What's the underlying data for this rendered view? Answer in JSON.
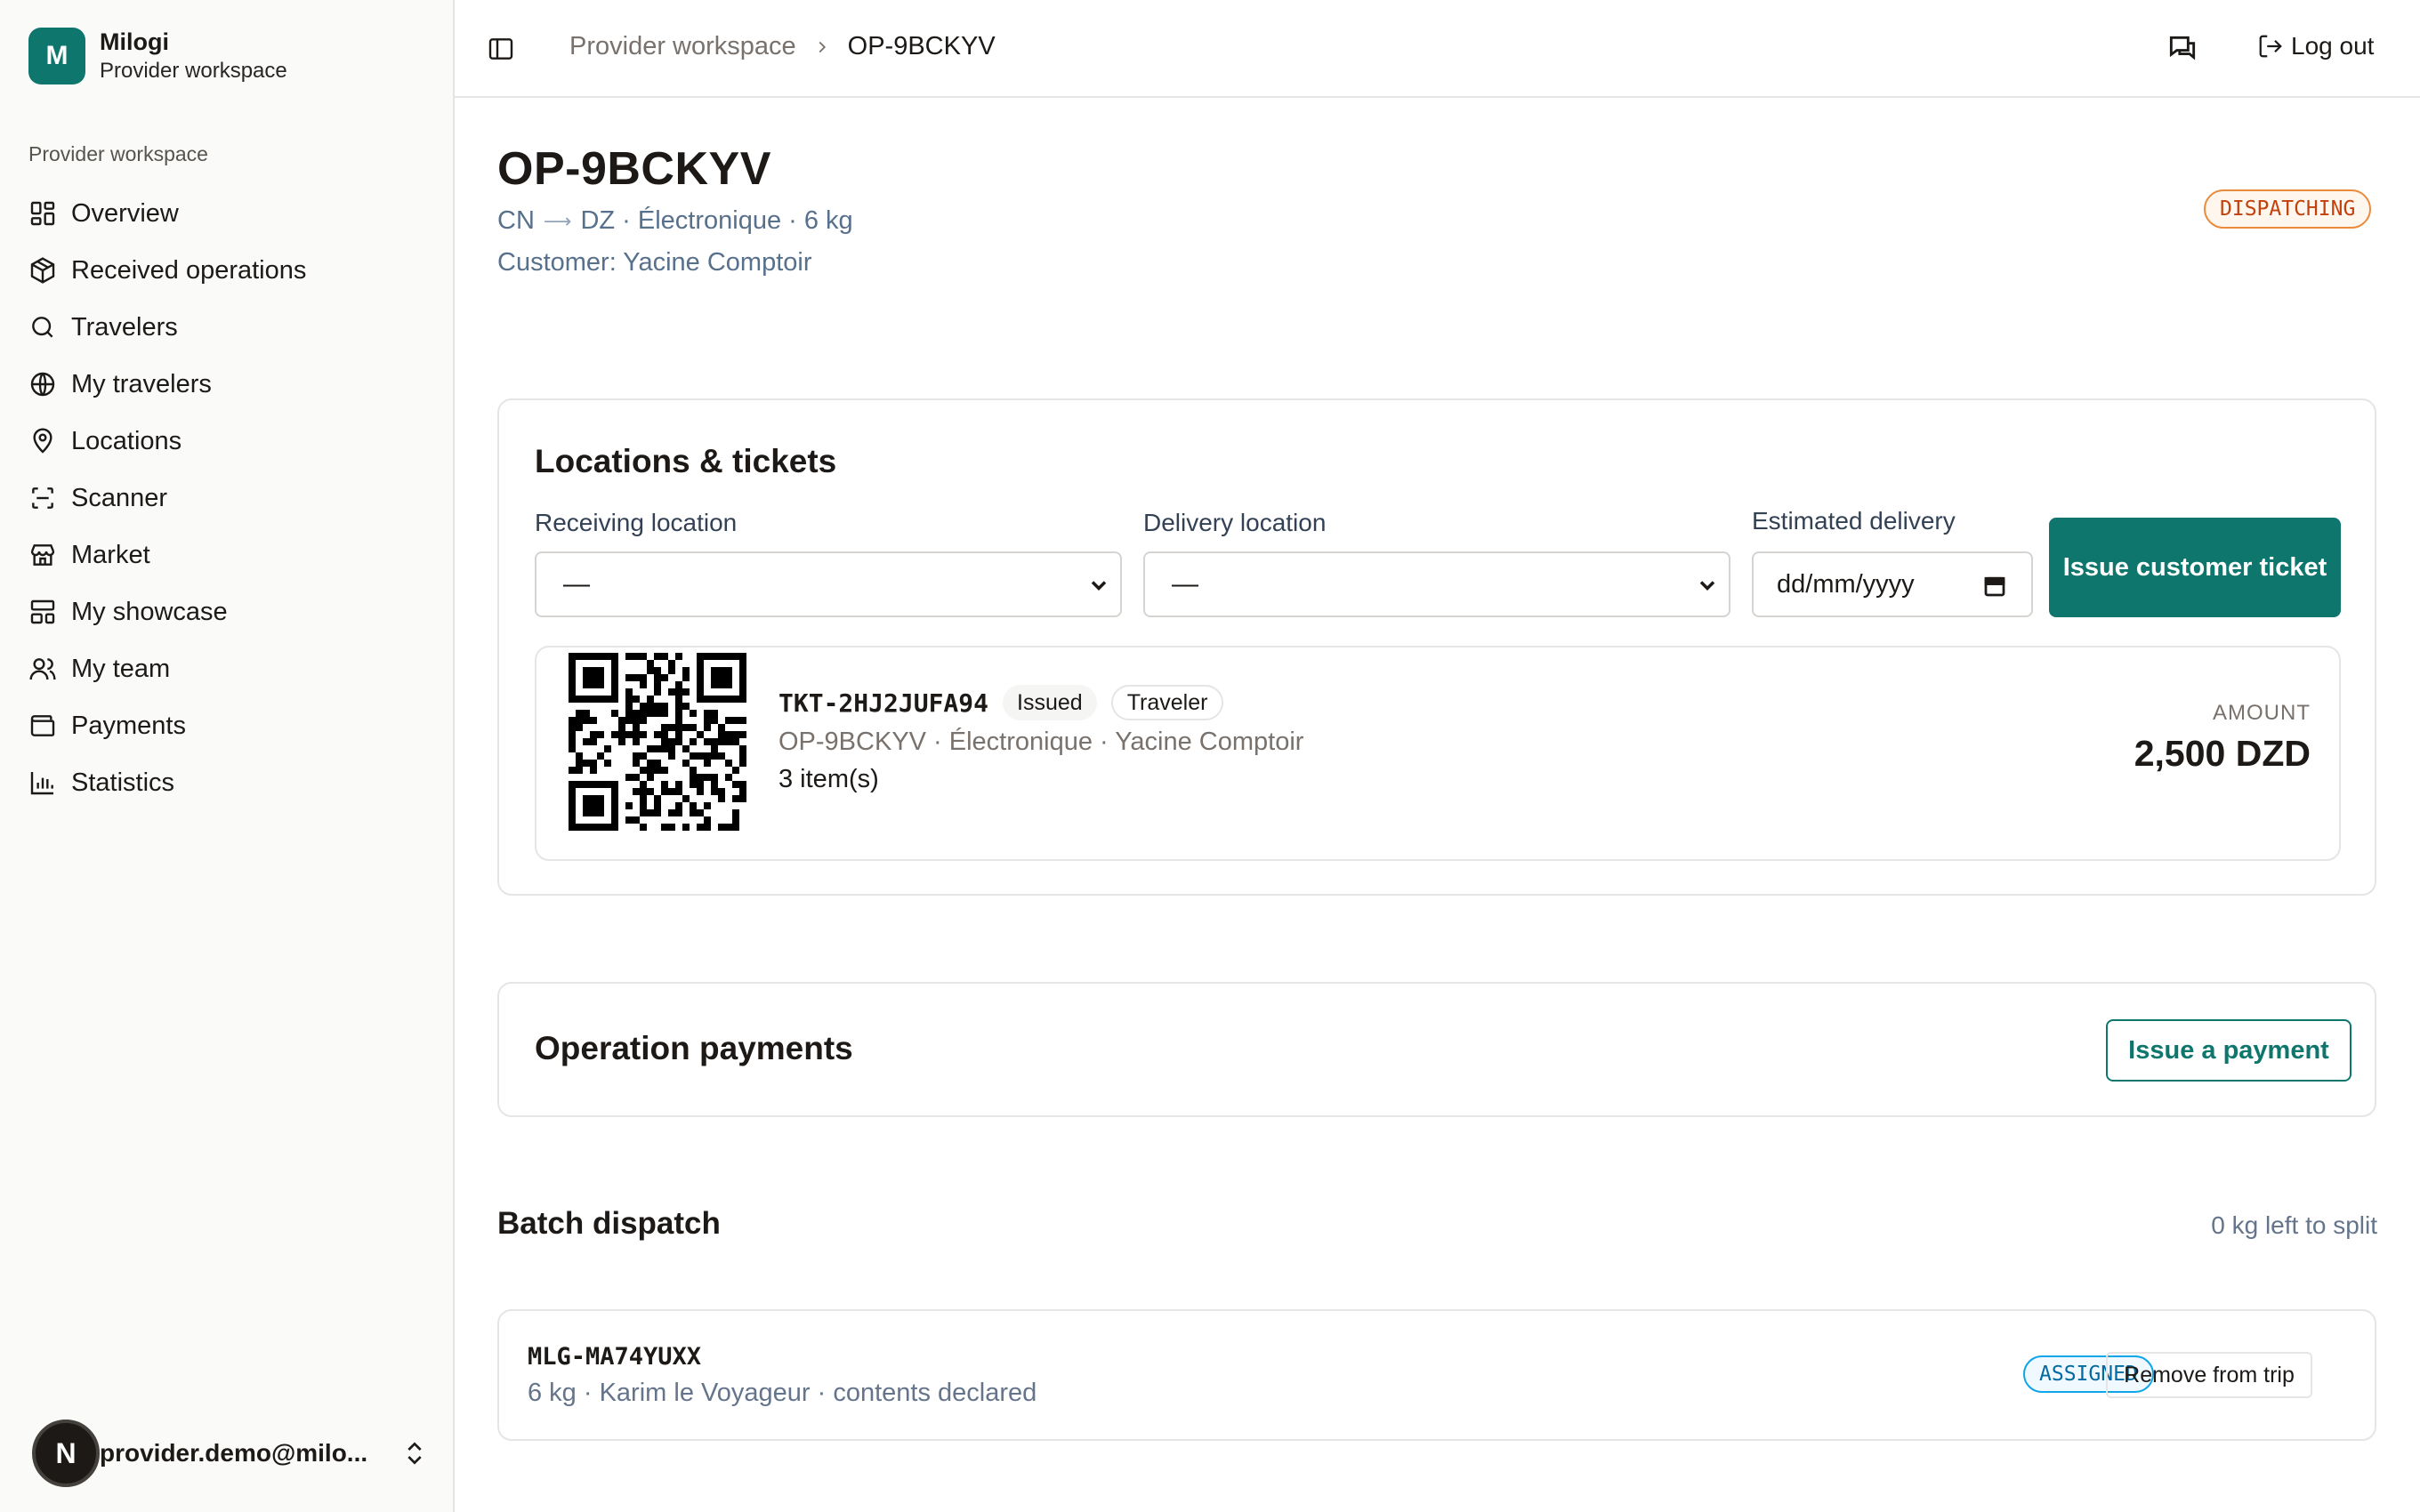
{
  "brand": {
    "initial": "M",
    "name": "Milogi",
    "subtitle": "Provider workspace"
  },
  "sidebar": {
    "group_label": "Provider workspace",
    "items": [
      {
        "label": "Overview",
        "icon": "grid-icon"
      },
      {
        "label": "Received operations",
        "icon": "package-icon"
      },
      {
        "label": "Travelers",
        "icon": "search-icon"
      },
      {
        "label": "My travelers",
        "icon": "globe-icon"
      },
      {
        "label": "Locations",
        "icon": "map-pin-icon"
      },
      {
        "label": "Scanner",
        "icon": "scan-icon"
      },
      {
        "label": "Market",
        "icon": "store-icon"
      },
      {
        "label": "My showcase",
        "icon": "layout-icon"
      },
      {
        "label": "My team",
        "icon": "users-icon"
      },
      {
        "label": "Payments",
        "icon": "wallet-icon"
      },
      {
        "label": "Statistics",
        "icon": "bar-chart-icon"
      }
    ],
    "user": {
      "initial": "N",
      "email": "provider.demo@milo..."
    }
  },
  "topbar": {
    "breadcrumb_parent": "Provider workspace",
    "breadcrumb_current": "OP-9BCKYV",
    "logout_label": "Log out"
  },
  "operation": {
    "code": "OP-9BCKYV",
    "origin": "CN",
    "destination": "DZ · Électronique · 6 kg",
    "customer": "Customer: Yacine Comptoir",
    "status": "DISPATCHING"
  },
  "locations": {
    "title": "Locations & tickets",
    "receiving_label": "Receiving location",
    "receiving_value": "—",
    "delivery_label": "Delivery location",
    "delivery_value": "—",
    "estimated_label": "Estimated delivery",
    "estimated_placeholder": "dd/mm/yyyy",
    "issue_ticket_label": "Issue customer ticket"
  },
  "ticket": {
    "code": "TKT-2HJ2JUFA94",
    "status_tag": "Issued",
    "type_tag": "Traveler",
    "meta": "OP-9BCKYV · Électronique · Yacine Comptoir",
    "items": "3 item(s)",
    "amount_label": "AMOUNT",
    "amount_value": "2,500 DZD"
  },
  "payments": {
    "title": "Operation payments",
    "issue_label": "Issue a payment"
  },
  "batch": {
    "title": "Batch dispatch",
    "left_to_split": "0 kg left to split",
    "items": [
      {
        "code": "MLG-MA74YUXX",
        "meta": "6 kg · Karim le Voyageur · contents declared",
        "status": "ASSIGNED",
        "remove_label": "Remove from trip"
      }
    ]
  },
  "colors": {
    "accent": "#0f766e",
    "status_dispatching": "#c2410c",
    "status_assigned": "#0369a1"
  }
}
